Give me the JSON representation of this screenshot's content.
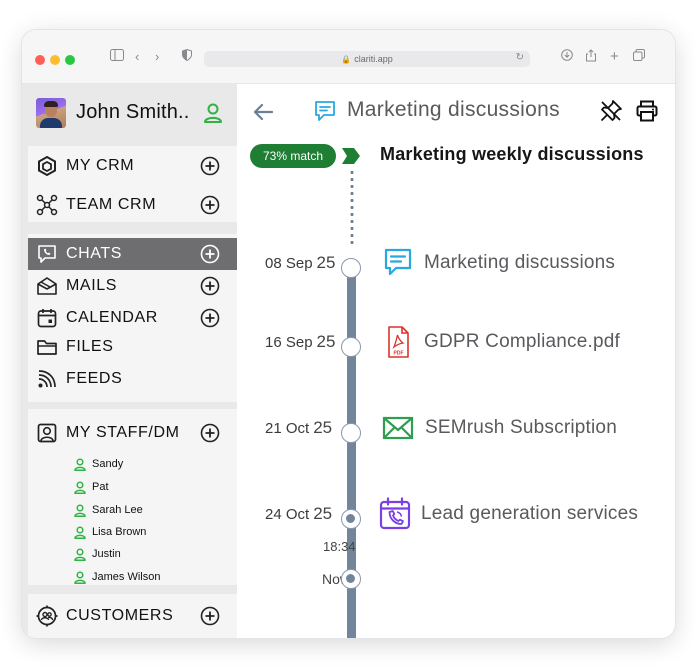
{
  "browser": {
    "url": "clariti.app"
  },
  "user": {
    "name": "John Smith.."
  },
  "sidebar": {
    "crm": [
      {
        "label": "MY CRM"
      },
      {
        "label": "TEAM CRM"
      }
    ],
    "comms": [
      {
        "label": "CHATS",
        "active": true
      },
      {
        "label": "MAILS"
      },
      {
        "label": "CALENDAR"
      },
      {
        "label": "FILES"
      },
      {
        "label": "FEEDS"
      }
    ],
    "staff": {
      "label": "MY STAFF/DM",
      "members": [
        "Sandy",
        "Pat",
        "Sarah Lee",
        "Lisa Brown",
        "Justin",
        "James Wilson"
      ]
    },
    "customers": {
      "label": "CUSTOMERS"
    }
  },
  "header": {
    "title": "Marketing discussions"
  },
  "thread": {
    "match": "73% match",
    "title": "Marketing weekly discussions"
  },
  "timeline": [
    {
      "date": "08 Sep",
      "day_num": "25",
      "label": "Marketing discussions",
      "icon": "chat-icon"
    },
    {
      "date": "16 Sep",
      "day_num": "25",
      "label": "GDPR Compliance.pdf",
      "icon": "pdf-icon"
    },
    {
      "date": "21 Oct",
      "day_num": "25",
      "label": "SEMrush Subscription",
      "icon": "mail-icon"
    },
    {
      "date": "24 Oct",
      "day_num": "25",
      "time": "18:34",
      "label": "Lead generation services",
      "icon": "calendar-call-icon"
    }
  ],
  "now_label": "Now",
  "colors": {
    "accent_green": "#1e7e34",
    "user_green": "#2fb344",
    "chat_blue": "#29a8e0",
    "pdf_red": "#d9342b",
    "mail_green": "#2e9e4f",
    "calendar_purple": "#7b3fe4",
    "rail": "#73859b",
    "active_nav": "#6e6e70"
  }
}
